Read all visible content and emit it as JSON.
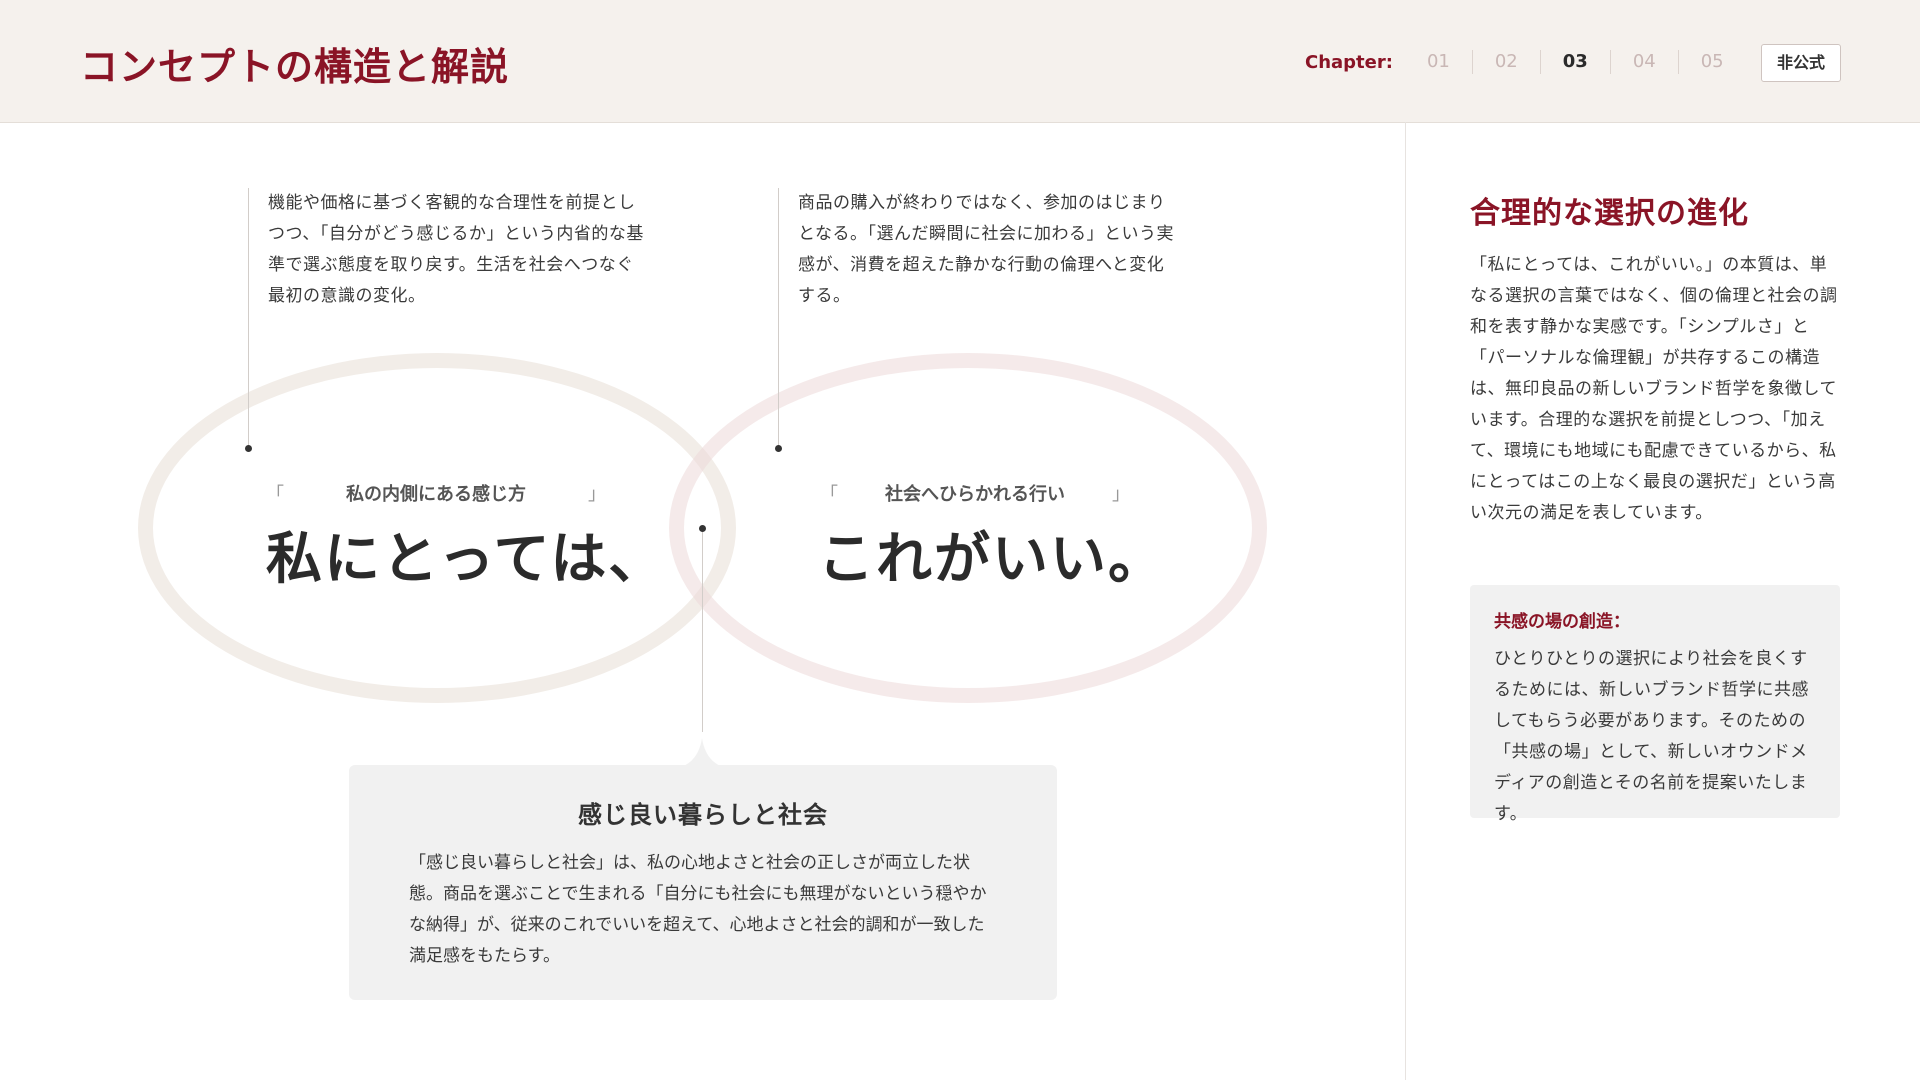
{
  "header": {
    "title": "コンセプトの構造と解説",
    "chapter_label": "Chapter:",
    "chapters": [
      "01",
      "02",
      "03",
      "04",
      "05"
    ],
    "active_chapter": "03",
    "badge": "非公式"
  },
  "diagram": {
    "left": {
      "description": "機能や価格に基づく客観的な合理性を前提としつつ、「自分がどう感じるか」という内省的な基準で選ぶ態度を取り戻す。生活を社会へつなぐ最初の意識の変化。",
      "bracket_open": "「",
      "label": "私の内側にある感じ方",
      "bracket_close": "」",
      "headline": "私にとっては、"
    },
    "right": {
      "description": "商品の購入が終わりではなく、参加のはじまりとなる。「選んだ瞬間に社会に加わる」という実感が、消費を超えた静かな行動の倫理へと変化する。",
      "bracket_open": "「",
      "label": "社会へひらかれる行い",
      "bracket_close": "」",
      "headline": "これがいい。"
    },
    "intersection": {
      "title": "感じ良い暮らしと社会",
      "text": "「感じ良い暮らしと社会」は、私の心地よさと社会の正しさが両立した状態。商品を選ぶことで生まれる「自分にも社会にも無理がないという穏やかな納得」が、従来のこれでいいを超えて、心地よさと社会的調和が一致した満足感をもたらす。"
    }
  },
  "sidebar": {
    "heading": "合理的な選択の進化",
    "text": "「私にとっては、これがいい。」の本質は、単なる選択の言葉ではなく、個の倫理と社会の調和を表す静かな実感です。「シンプルさ」と「パーソナルな倫理観」が共存するこの構造は、無印良品の新しいブランド哲学を象徴しています。合理的な選択を前提としつつ、「加えて、環境にも地域にも配慮できているから、私にとってはこの上なく最良の選択だ」という高い次元の満足を表しています。",
    "box": {
      "title": "共感の場の創造：",
      "text": "ひとりひとりの選択により社会を良くするためには、新しいブランド哲学に共感してもらう必要があります。そのための「共感の場」として、新しいオウンドメディアの創造とその名前を提案いたします。"
    }
  },
  "colors": {
    "accent": "#8a1426",
    "header_bg": "#f5f1ed",
    "box_bg": "#f1f1f1"
  }
}
